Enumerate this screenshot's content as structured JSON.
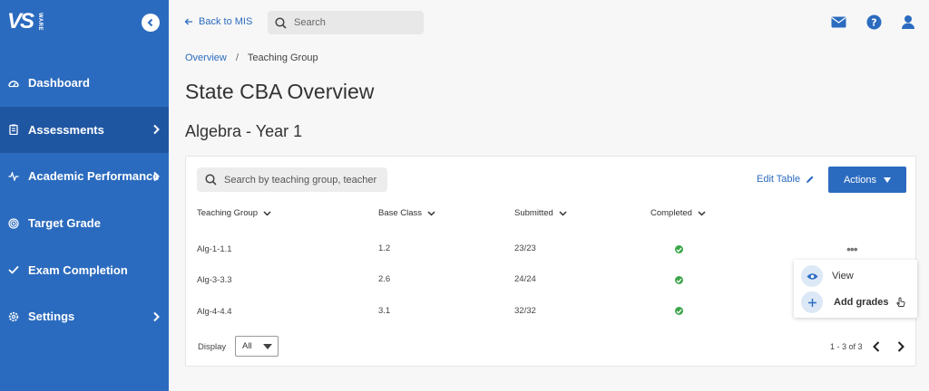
{
  "app": {
    "logo_text": "VS",
    "logo_sub": "WARE"
  },
  "sidebar": {
    "items": [
      {
        "label": "Dashboard",
        "icon": "gauge-icon",
        "has_chevron": false,
        "active": false
      },
      {
        "label": "Assessments",
        "icon": "clipboard-icon",
        "has_chevron": true,
        "active": true
      },
      {
        "label": "Academic Performance",
        "icon": "activity-icon",
        "has_chevron": true,
        "active": false
      },
      {
        "label": "Target Grade",
        "icon": "target-icon",
        "has_chevron": false,
        "active": false
      },
      {
        "label": "Exam Completion",
        "icon": "check-icon",
        "has_chevron": false,
        "active": false
      },
      {
        "label": "Settings",
        "icon": "gear-icon",
        "has_chevron": true,
        "active": false
      }
    ]
  },
  "topbar": {
    "back_label": "Back to MIS",
    "search_placeholder": "Search"
  },
  "breadcrumb": {
    "link": "Overview",
    "separator": "/",
    "current": "Teaching Group"
  },
  "page": {
    "title": "State CBA Overview",
    "subtitle": "Algebra - Year 1"
  },
  "table": {
    "search_placeholder": "Search by teaching group, teacher",
    "edit_label": "Edit Table",
    "actions_label": "Actions",
    "columns": [
      "Teaching Group",
      "Base Class",
      "Submitted",
      "Completed"
    ],
    "rows": [
      {
        "group": "Alg-1-1.1",
        "base_class": "1.2",
        "submitted": "23/23",
        "completed": true
      },
      {
        "group": "Alg-3-3.3",
        "base_class": "2.6",
        "submitted": "24/24",
        "completed": true
      },
      {
        "group": "Alg-4-4.4",
        "base_class": "3.1",
        "submitted": "32/32",
        "completed": true
      }
    ],
    "row_menu": {
      "more_label": "•••",
      "items": [
        "View",
        "Add grades"
      ]
    },
    "display_label": "Display",
    "display_value": "All",
    "pagination": "1 - 3 of 3"
  },
  "colors": {
    "primary": "#2b6bbf",
    "sidebar_active": "#1f56a2",
    "success": "#3da64b"
  }
}
